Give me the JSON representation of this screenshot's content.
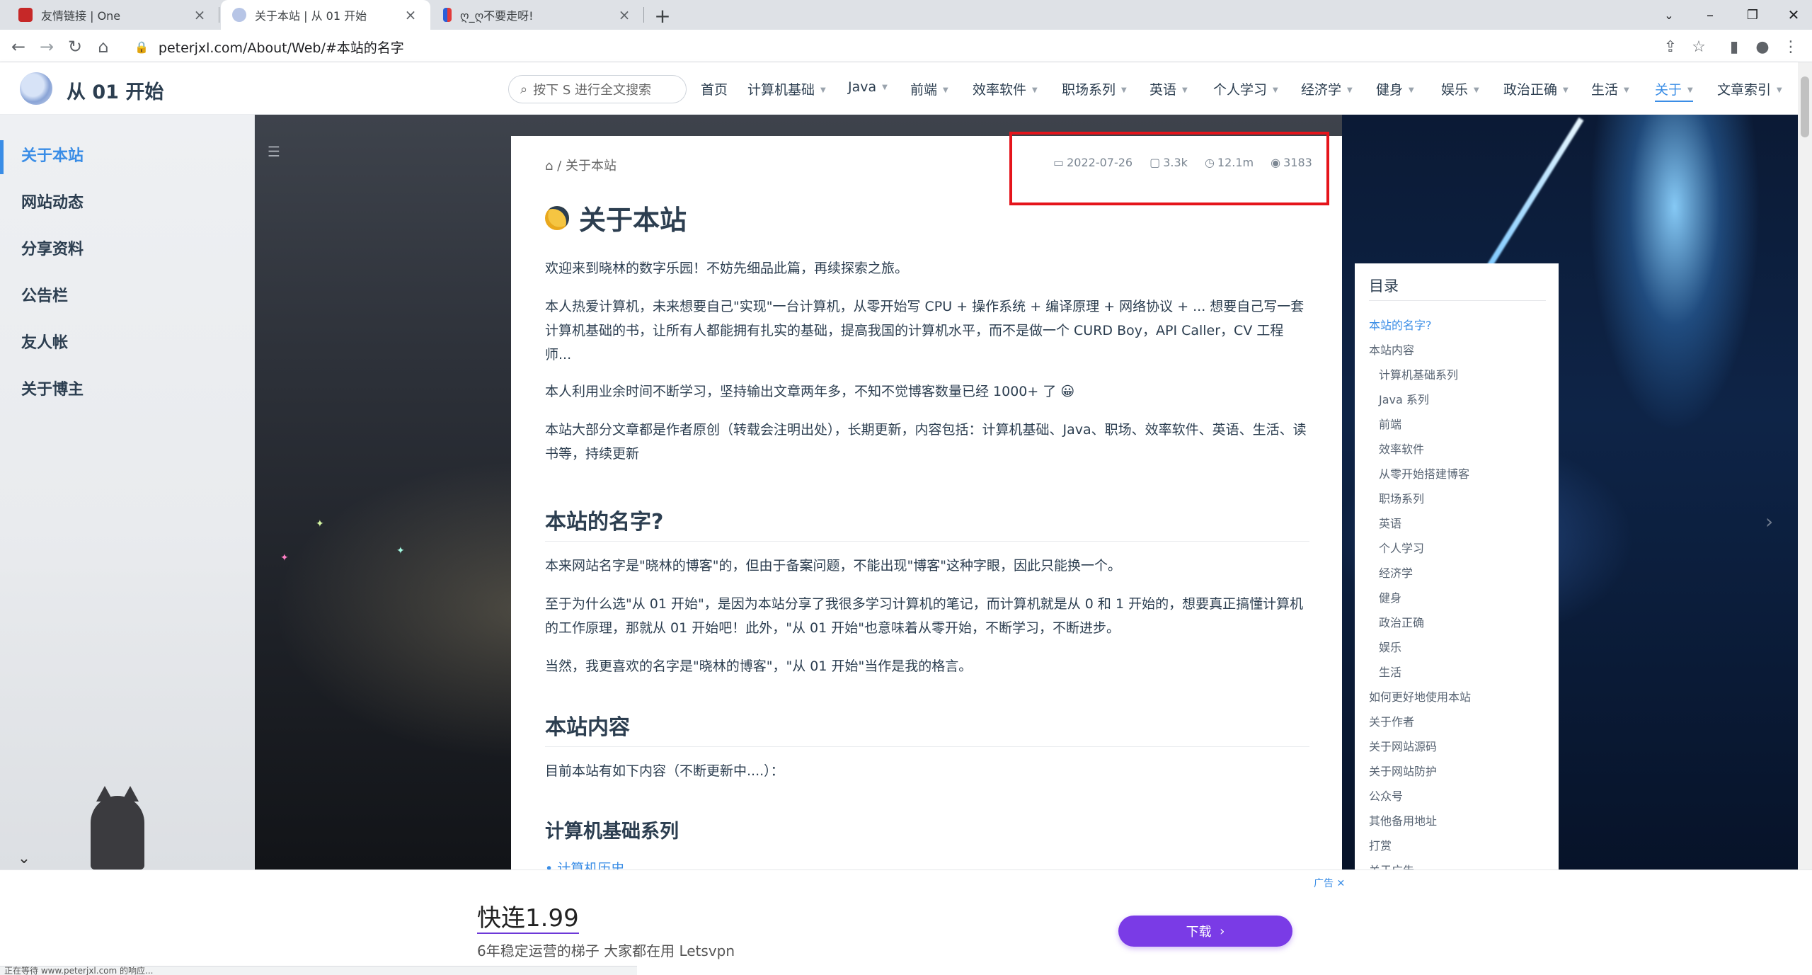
{
  "browser": {
    "tabs": [
      {
        "title": "友情链接 | One",
        "active": false
      },
      {
        "title": "关于本站 | 从 01 开始",
        "active": true
      },
      {
        "title": "ღ_ღ不要走呀!",
        "active": false
      }
    ],
    "url": "peterjxl.com/About/Web/#本站的名字",
    "status_text": "正在等待 www.peterjxl.com 的响应..."
  },
  "site": {
    "name": "从 01 开始",
    "search_placeholder": "按下 S 进行全文搜索",
    "nav": [
      {
        "label": "首页",
        "dropdown": false
      },
      {
        "label": "计算机基础",
        "dropdown": true
      },
      {
        "label": "Java",
        "dropdown": true
      },
      {
        "label": "前端",
        "dropdown": true
      },
      {
        "label": "效率软件",
        "dropdown": true
      },
      {
        "label": "职场系列",
        "dropdown": true
      },
      {
        "label": "英语",
        "dropdown": true
      },
      {
        "label": "个人学习",
        "dropdown": true
      },
      {
        "label": "经济学",
        "dropdown": true
      },
      {
        "label": "健身",
        "dropdown": true
      },
      {
        "label": "娱乐",
        "dropdown": true
      },
      {
        "label": "政治正确",
        "dropdown": true
      },
      {
        "label": "生活",
        "dropdown": true
      },
      {
        "label": "关于",
        "dropdown": true,
        "active": true
      },
      {
        "label": "文章索引",
        "dropdown": true
      }
    ]
  },
  "sidebar": {
    "items": [
      "关于本站",
      "网站动态",
      "分享资料",
      "公告栏",
      "友人帐",
      "关于博主"
    ]
  },
  "article": {
    "breadcrumb": "/ 关于本站",
    "meta": {
      "date": "2022-07-26",
      "words": "3.3k",
      "read_time": "12.1m",
      "views": "3183"
    },
    "title": "关于本站",
    "paragraphs": [
      "欢迎来到晓林的数字乐园！不妨先细品此篇，再续探索之旅。",
      "本人热爱计算机，未来想要自己\"实现\"一台计算机，从零开始写 CPU + 操作系统 + 编译原理 + 网络协议 + ... 想要自己写一套计算机基础的书，让所有人都能拥有扎实的基础，提高我国的计算机水平，而不是做一个 CURD Boy，API Caller，CV 工程师...",
      "本人利用业余时间不断学习，坚持输出文章两年多，不知不觉博客数量已经 1000+ 了 😀",
      "本站大部分文章都是作者原创（转载会注明出处），长期更新，内容包括：计算机基础、Java、职场、效率软件、英语、生活、读书等，持续更新"
    ],
    "section1": {
      "heading": "本站的名字?",
      "paragraphs": [
        "本来网站名字是\"晓林的博客\"的，但由于备案问题，不能出现\"博客\"这种字眼，因此只能换一个。",
        "至于为什么选\"从 01 开始\"，是因为本站分享了我很多学习计算机的笔记，而计算机就是从 0 和 1 开始的，想要真正搞懂计算机的工作原理，那就从 01 开始吧！此外，\"从 01 开始\"也意味着从零开始，不断学习，不断进步。",
        "当然，我更喜欢的名字是\"晓林的博客\"，\"从 01 开始\"当作是我的格言。"
      ]
    },
    "section2": {
      "heading": "本站内容",
      "intro": "目前本站有如下内容（不断更新中....）："
    },
    "subsection": {
      "heading": "计算机基础系列",
      "first_item": "计算机历史"
    }
  },
  "toc": {
    "title": "目录",
    "items": [
      {
        "label": "本站的名字?",
        "level": 1,
        "active": true
      },
      {
        "label": "本站内容",
        "level": 1
      },
      {
        "label": "计算机基础系列",
        "level": 2
      },
      {
        "label": "Java 系列",
        "level": 2
      },
      {
        "label": "前端",
        "level": 2
      },
      {
        "label": "效率软件",
        "level": 2
      },
      {
        "label": "从零开始搭建博客",
        "level": 2
      },
      {
        "label": "职场系列",
        "level": 2
      },
      {
        "label": "英语",
        "level": 2
      },
      {
        "label": "个人学习",
        "level": 2
      },
      {
        "label": "经济学",
        "level": 2
      },
      {
        "label": "健身",
        "level": 2
      },
      {
        "label": "政治正确",
        "level": 2
      },
      {
        "label": "娱乐",
        "level": 2
      },
      {
        "label": "生活",
        "level": 2
      },
      {
        "label": "如何更好地使用本站",
        "level": 1
      },
      {
        "label": "关于作者",
        "level": 1
      },
      {
        "label": "关于网站源码",
        "level": 1
      },
      {
        "label": "关于网站防护",
        "level": 1
      },
      {
        "label": "公众号",
        "level": 1
      },
      {
        "label": "其他备用地址",
        "level": 1
      },
      {
        "label": "打赏",
        "level": 1
      },
      {
        "label": "关于广告",
        "level": 1
      }
    ]
  },
  "ad": {
    "title": "快连1.99",
    "subtitle": "6年稳定运营的梯子 大家都在用 Letsvpn",
    "button": "下载",
    "tag": "广告"
  },
  "colors": {
    "accent": "#3a8de6",
    "highlight_box": "#e5141b",
    "ad_button": "#7a3be6"
  },
  "icons": [
    "home-icon",
    "calendar-icon",
    "word-count-icon",
    "clock-icon",
    "eye-icon",
    "search-icon",
    "menu-icon",
    "chevron-down-icon"
  ]
}
